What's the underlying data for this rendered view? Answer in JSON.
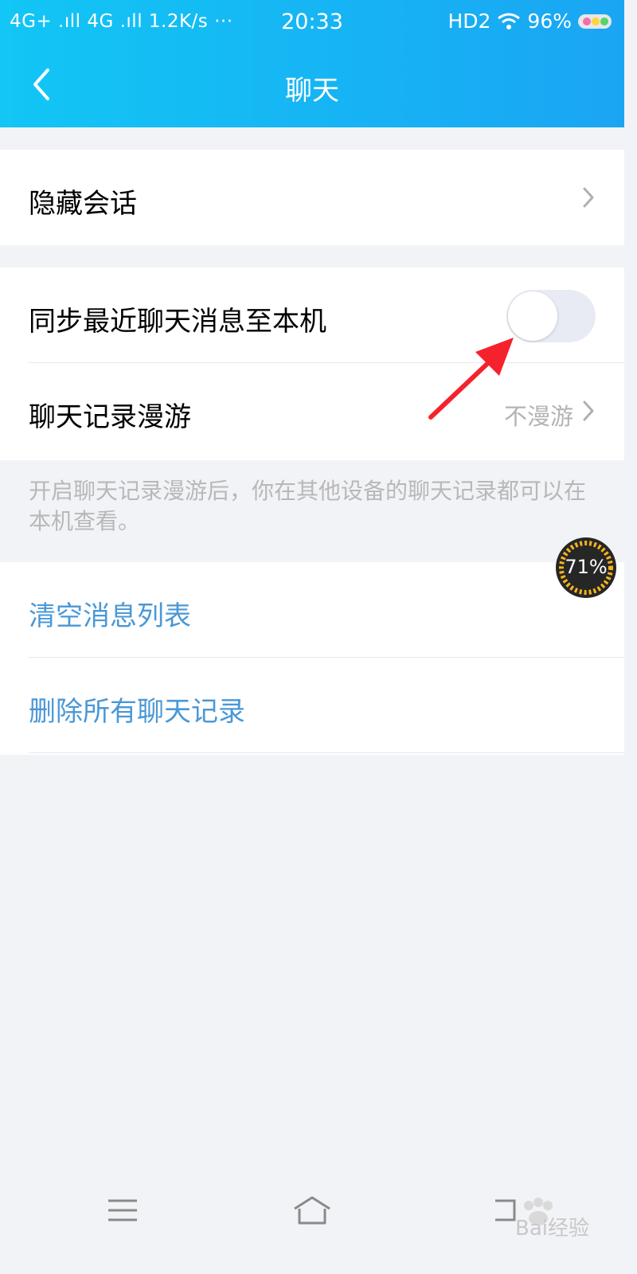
{
  "status_bar": {
    "left": "4G+ .ıll 4G .ıll 1.2K/s ···",
    "time": "20:33",
    "network": "HD2",
    "battery": "96%"
  },
  "nav": {
    "title": "聊天"
  },
  "settings": {
    "hide_chat": {
      "label": "隐藏会话"
    },
    "sync_recent": {
      "label": "同步最近聊天消息至本机",
      "enabled": false
    },
    "roaming": {
      "label": "聊天记录漫游",
      "value": "不漫游"
    },
    "hint": "开启聊天记录漫游后，你在其他设备的聊天记录都可以在本机查看。",
    "clear_list": {
      "label": "清空消息列表"
    },
    "delete_all": {
      "label": "删除所有聊天记录"
    }
  },
  "overlay": {
    "speed_percent": "71%"
  },
  "watermark": "Bai经验",
  "colors": {
    "header_start": "#12c6f5",
    "header_end": "#1aa5f3",
    "action_blue": "#4a98d6",
    "arrow_red": "#f5222d"
  }
}
